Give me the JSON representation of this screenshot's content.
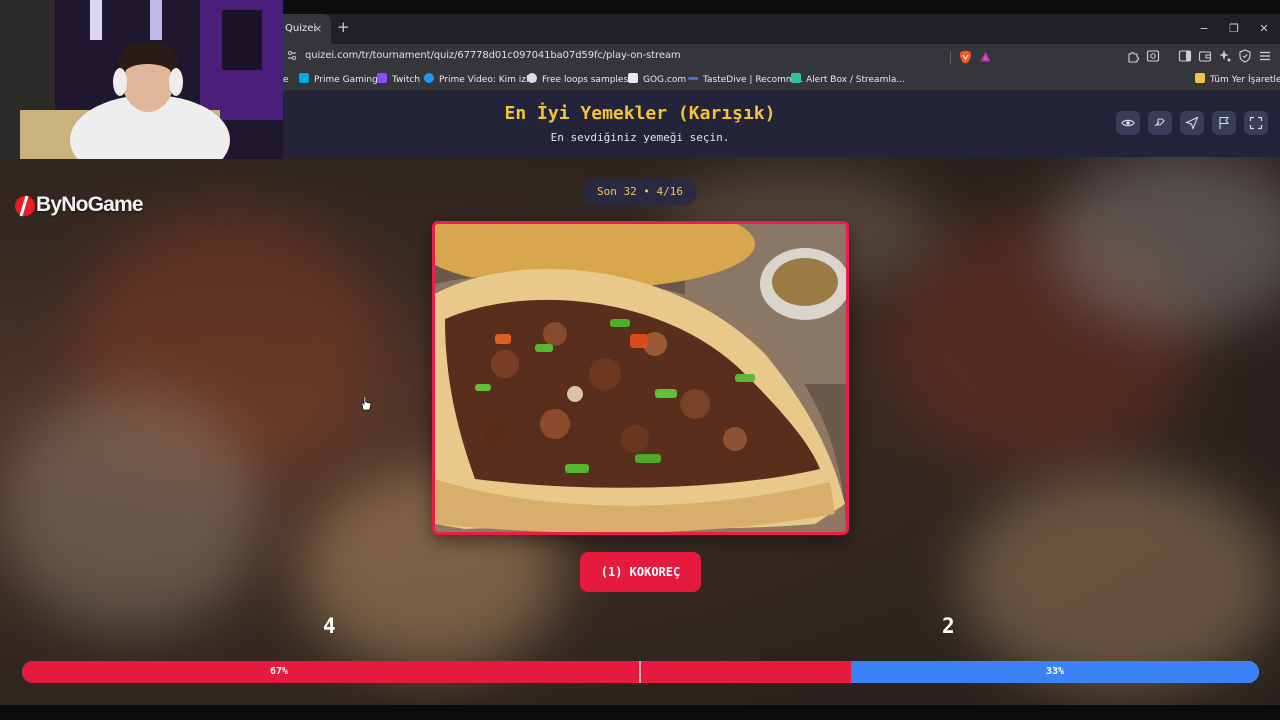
{
  "browser": {
    "tab_title": "Quizei",
    "tab_close": "×",
    "new_tab": "+",
    "window_controls": [
      "−",
      "❐",
      "✕"
    ],
    "url": "quizei.com/tr/tournament/quiz/67778d01c097041ba07d59fc/play-on-stream",
    "bookmarks": [
      {
        "label": "e",
        "icon": "partial-icon",
        "color": "#35363a"
      },
      {
        "label": "Prime Gaming",
        "icon": "prime-gaming-icon",
        "color": "#00a8e1"
      },
      {
        "label": "Twitch",
        "icon": "twitch-icon",
        "color": "#9146ff"
      },
      {
        "label": "Prime Video: Kim izl...",
        "icon": "prime-video-icon",
        "color": "#1a98ff"
      },
      {
        "label": "Free loops samples...",
        "icon": "loops-icon",
        "color": "#dddddd"
      },
      {
        "label": "GOG.com",
        "icon": "gog-icon",
        "color": "#eaeaea"
      },
      {
        "label": "TasteDive | Recomm...",
        "icon": "tastedive-icon",
        "color": "#4f6bd6"
      },
      {
        "label": "Alert Box / Streamla...",
        "icon": "streamlabs-icon",
        "color": "#31c3a2"
      }
    ],
    "all_bookmarks": "Tüm Yer İşaretleri"
  },
  "quiz": {
    "title": "En İyi Yemekler (Karışık)",
    "subtitle": "En sevdiğiniz yemeği seçin.",
    "header_buttons": [
      "eye-icon",
      "shuffle-icon",
      "send-icon",
      "flag-icon",
      "fullscreen-icon"
    ],
    "round": "Son 32 • 4/16",
    "choice_label": "(1) KOKOREÇ",
    "votes": {
      "left_count": "4",
      "right_count": "2",
      "left_percent_label": "67%",
      "right_percent_label": "33%",
      "left_share": 0.67,
      "right_share": 0.33
    }
  },
  "overlay": {
    "brand": "ByNoGame"
  },
  "colors": {
    "accent_red": "#e6193f",
    "accent_blue": "#3b82f6",
    "title_yellow": "#f5c33b",
    "header_bg": "#23233a"
  }
}
